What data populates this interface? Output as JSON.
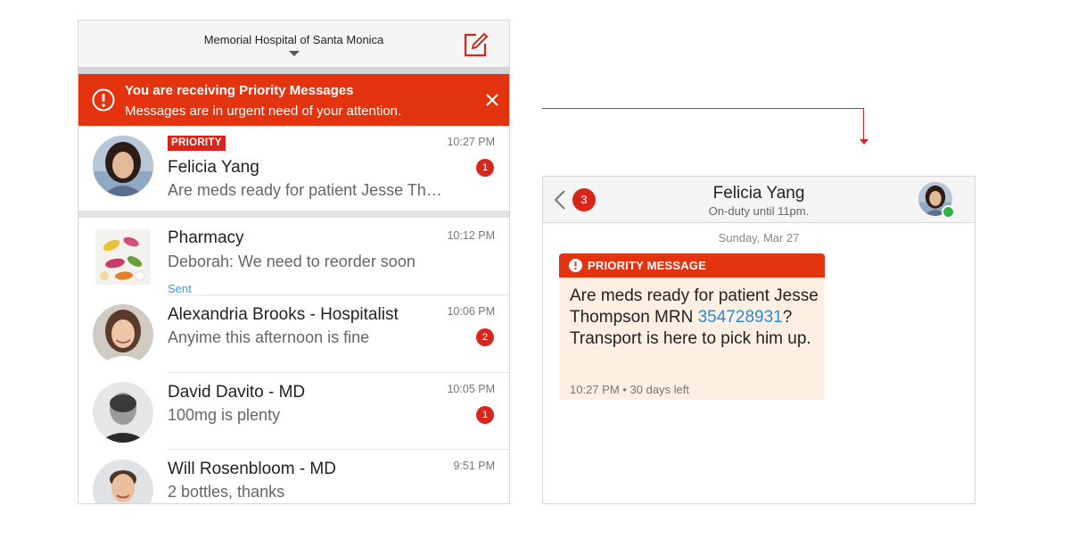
{
  "left": {
    "header": {
      "hospital": "Memorial Hospital of Santa Monica"
    },
    "banner": {
      "title": "You are receiving Priority Messages",
      "subtitle": "Messages are in urgent need of your attention."
    },
    "priority_item": {
      "tag": "PRIORITY",
      "name": "Felicia Yang",
      "time": "10:27 PM",
      "preview": "Are meds ready for patient Jesse Th…",
      "unread": "1"
    },
    "conversations": [
      {
        "name": "Pharmacy",
        "time": "10:12 PM",
        "preview": "Deborah: We need to reorder soon",
        "status": "Sent"
      },
      {
        "name": "Alexandria Brooks - Hospitalist",
        "time": "10:06 PM",
        "preview": "Anyime this afternoon is fine",
        "unread": "2"
      },
      {
        "name": "David Davito - MD",
        "time": "10:05 PM",
        "preview": "100mg is plenty",
        "unread": "1"
      },
      {
        "name": "Will Rosenbloom - MD",
        "time": "9:51 PM",
        "preview": "2 bottles, thanks"
      }
    ]
  },
  "right": {
    "header": {
      "back_count": "3",
      "name": "Felicia Yang",
      "status": "On-duty until 11pm."
    },
    "date": "Sunday, Mar 27",
    "message": {
      "label": "PRIORITY MESSAGE",
      "text_before": "Are meds ready for patient Jesse Thompson MRN ",
      "link": "354728931",
      "text_after": "? Transport is here to pick him up.",
      "time": "10:27 PM",
      "separator": " • ",
      "expiry": "30 days left"
    }
  },
  "colors": {
    "priority_red": "#e4330f",
    "badge_red": "#d9261c",
    "bubble_bg": "#fdf0e3",
    "link_blue": "#2a8ad8",
    "sent_blue": "#3a9bd6",
    "presence_green": "#2eb34a"
  },
  "icons": {
    "compose": "compose-icon",
    "alert": "alert-circle-icon",
    "close": "close-icon",
    "back": "chevron-left-icon",
    "dropdown": "caret-down-icon"
  }
}
